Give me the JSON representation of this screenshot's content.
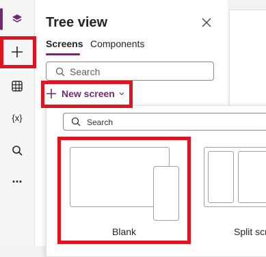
{
  "rail": {
    "items": [
      {
        "icon": "layers-icon"
      },
      {
        "icon": "plus-icon"
      },
      {
        "icon": "grid-icon"
      },
      {
        "icon": "variables-icon",
        "label": "{x}"
      },
      {
        "icon": "search-icon"
      },
      {
        "icon": "more-icon",
        "label": "···"
      }
    ]
  },
  "panel": {
    "title": "Tree view",
    "tabs": [
      {
        "label": "Screens",
        "active": true
      },
      {
        "label": "Components",
        "active": false
      }
    ],
    "search_placeholder": "Search",
    "new_screen_label": "New screen"
  },
  "flyout": {
    "search_placeholder": "Search",
    "layouts": [
      {
        "label": "Blank"
      },
      {
        "label": "Split scr"
      }
    ]
  },
  "colors": {
    "accent": "#742774",
    "highlight": "#e0141e"
  }
}
